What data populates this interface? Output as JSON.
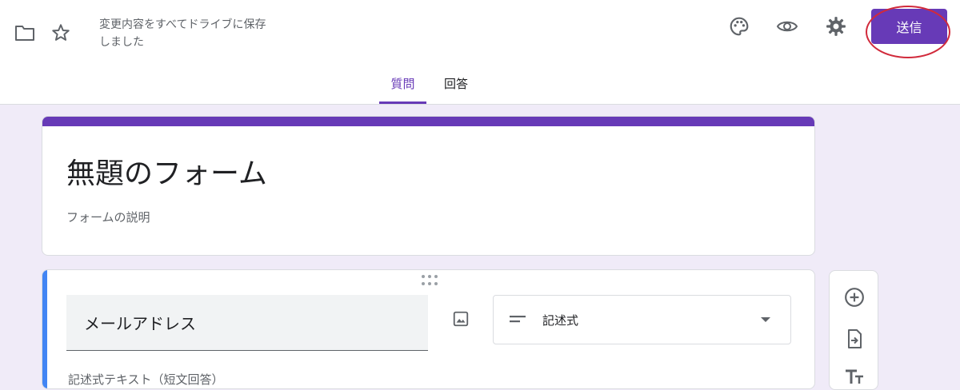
{
  "header": {
    "save_status": "変更内容をすべてドライブに保存しました",
    "send_label": "送信",
    "icons": [
      "folder-icon",
      "star-icon",
      "palette-icon",
      "eye-icon",
      "gear-icon"
    ]
  },
  "tabs": [
    {
      "label": "質問",
      "active": true
    },
    {
      "label": "回答",
      "active": false
    }
  ],
  "form": {
    "title": "無題のフォーム",
    "description": "フォームの説明"
  },
  "question": {
    "title": "メールアドレス",
    "type_label": "記述式",
    "answer_hint": "記述式テキスト（短文回答）"
  },
  "side_toolbar": {
    "icons": [
      "add-question-icon",
      "import-questions-icon",
      "add-title-icon"
    ]
  },
  "colors": {
    "accent": "#673ab7",
    "background": "#f0ebf8",
    "question_bar": "#4285f4",
    "annotation": "#d12a3b"
  }
}
